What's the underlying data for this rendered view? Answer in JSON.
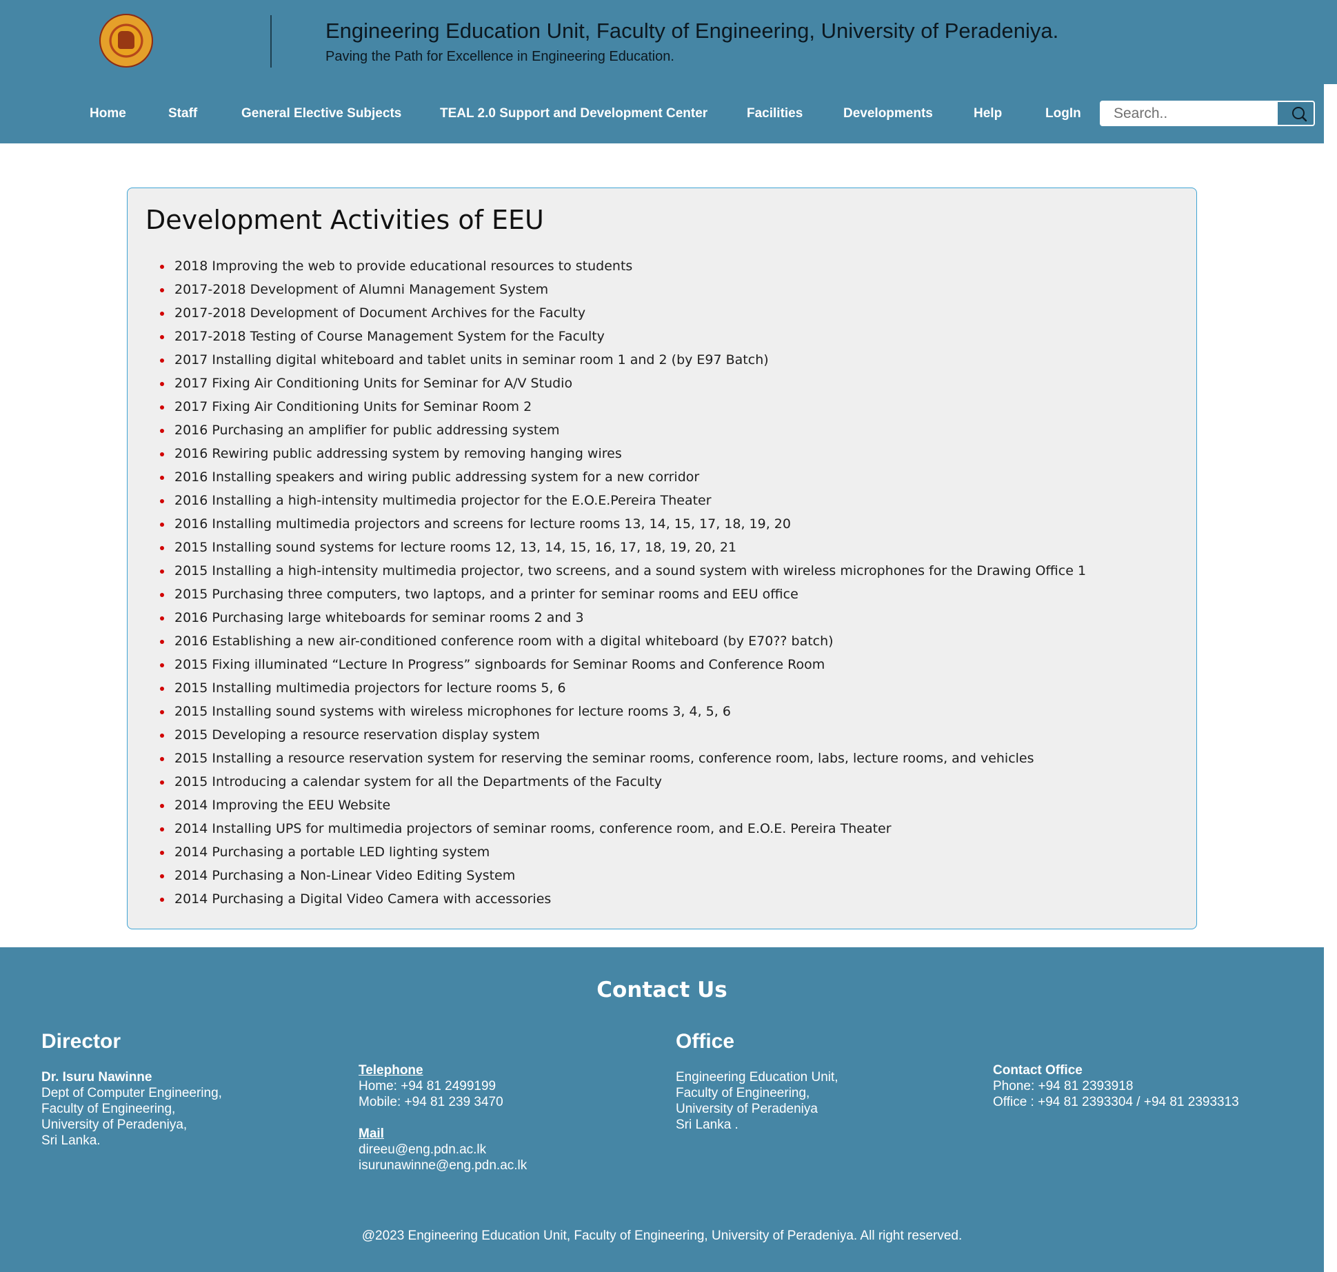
{
  "header": {
    "title": "Engineering Education Unit, Faculty of Engineering, University of Peradeniya.",
    "tagline": "Paving the Path for Excellence in Engineering Education."
  },
  "nav": {
    "items": [
      "Home",
      "Staff",
      "General Elective Subjects",
      "TEAL 2.0 Support and Development Center",
      "Facilities",
      "Developments",
      "Help",
      "LogIn"
    ]
  },
  "search": {
    "placeholder": "Search.."
  },
  "main": {
    "title": "Development Activities of EEU",
    "activities": [
      "2018 Improving the web to provide educational resources to students",
      "2017-2018 Development of Alumni Management System",
      "2017-2018 Development of Document Archives for the Faculty",
      "2017-2018 Testing of Course Management System for the Faculty",
      "2017 Installing digital whiteboard and tablet units in seminar room 1 and 2 (by E97 Batch)",
      "2017 Fixing Air Conditioning Units for Seminar for A/V Studio",
      "2017 Fixing Air Conditioning Units for Seminar Room 2",
      "2016 Purchasing an amplifier for public addressing system",
      "2016 Rewiring public addressing system by removing hanging wires",
      "2016 Installing speakers and wiring public addressing system for a new corridor",
      "2016 Installing a high-intensity multimedia projector for the E.O.E.Pereira Theater",
      "2016 Installing multimedia projectors and screens for lecture rooms 13, 14, 15, 17, 18, 19, 20",
      "2015 Installing sound systems for lecture rooms 12, 13, 14, 15, 16, 17, 18, 19, 20, 21",
      "2015 Installing a high-intensity multimedia projector, two screens, and a sound system with wireless microphones for the Drawing Office 1",
      "2015 Purchasing three computers, two laptops, and a printer for seminar rooms and EEU office",
      "2016 Purchasing large whiteboards for seminar rooms 2 and 3",
      "2016 Establishing a new air-conditioned conference room with a digital whiteboard (by E70?? batch)",
      "2015 Fixing illuminated “Lecture In Progress” signboards for Seminar Rooms and Conference Room",
      "2015 Installing multimedia projectors for lecture rooms 5, 6",
      "2015 Installing sound systems with wireless microphones for lecture rooms 3, 4, 5, 6",
      "2015 Developing a resource reservation display system",
      "2015 Installing a resource reservation system for reserving the seminar rooms, conference room, labs, lecture rooms, and vehicles",
      "2015 Introducing a calendar system for all the Departments of the Faculty",
      "2014 Improving the EEU Website",
      "2014 Installing UPS for multimedia projectors of seminar rooms, conference room, and E.O.E. Pereira Theater",
      "2014 Purchasing a portable LED lighting system",
      "2014 Purchasing a Non-Linear Video Editing System",
      "2014 Purchasing a Digital Video Camera with accessories"
    ]
  },
  "footer": {
    "heading": "Contact Us",
    "director": {
      "heading": "Director",
      "name": "Dr. Isuru Nawinne",
      "lines": [
        "Dept of Computer Engineering,",
        "Faculty of Engineering,",
        "University of Peradeniya,",
        "Sri Lanka."
      ]
    },
    "director_contact": {
      "telephone_label": "Telephone",
      "home": "Home: +94 81 2499199",
      "mobile": "Mobile: +94 81 239 3470",
      "mail_label": "Mail",
      "email1": "direeu@eng.pdn.ac.lk",
      "email2": "isurunawinne@eng.pdn.ac.lk"
    },
    "office": {
      "heading": "Office",
      "lines": [
        "Engineering Education Unit,",
        "Faculty of Engineering,",
        "University of Peradeniya",
        "Sri Lanka ."
      ]
    },
    "office_contact": {
      "label": "Contact Office",
      "phone": "Phone: +94 81 2393918",
      "office": "Office : +94 81 2393304 / +94 81 2393313"
    },
    "copyright": "@2023 Engineering Education Unit, Faculty of Engineering, University of Peradeniya. All right reserved."
  },
  "colors": {
    "brand": "#4686a5",
    "card_bg": "#efefef",
    "card_border": "#3fa4d4",
    "bullet": "#d10000"
  },
  "icons": {
    "logo": "university-crest",
    "search": "magnifier-icon"
  }
}
